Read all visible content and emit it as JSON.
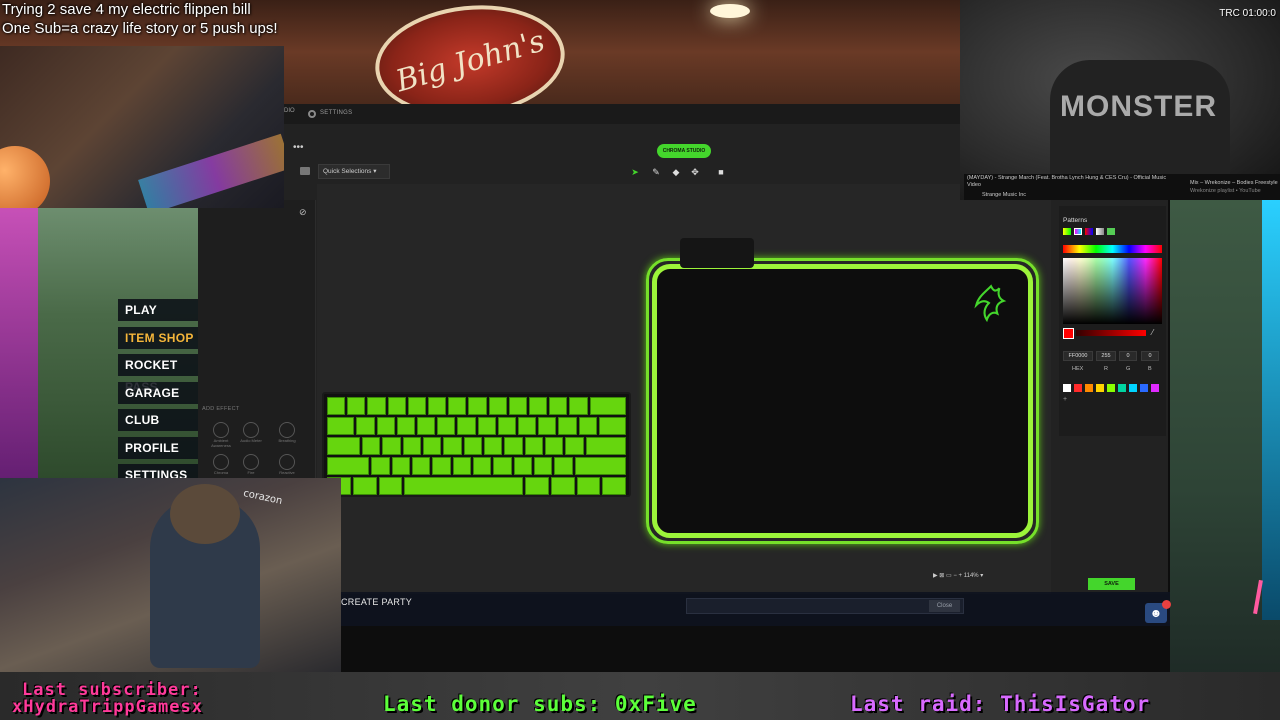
{
  "overlay": {
    "title_line1": "Trying 2 save 4 my electric flippen bill",
    "title_line2": "One Sub=a crazy life story or 5 push ups!",
    "clock": "TRC 01:00:0",
    "youtube": {
      "video_title": "(MAYDAY) - Strange March (Feat. Brotha Lynch Hung & CES Cru) - Official Music Video",
      "channel": "Strange Music Inc",
      "side_title": "Mix – Wrekonize – Bodies Freestyle",
      "side_sub": "Wrekonize playlist • YouTube"
    },
    "shirt_text": "MONSTER",
    "corazon": "corazon",
    "diner_sign": "Big John's"
  },
  "rocket_league": {
    "menu": [
      {
        "label": "PLAY",
        "active": false
      },
      {
        "label": "ITEM SHOP",
        "active": true
      },
      {
        "label": "ROCKET PASS",
        "active": false
      },
      {
        "label": "GARAGE",
        "active": false
      },
      {
        "label": "CLUB",
        "active": false
      },
      {
        "label": "PROFILE",
        "active": false
      },
      {
        "label": "SETTINGS",
        "active": false
      }
    ],
    "create_party": "CREATE PARTY",
    "close_label": "Close"
  },
  "synapse": {
    "tab_partial": "DIO",
    "settings_tab": "SETTINGS",
    "chroma_studio": "CHROMA STUDIO",
    "quick_selections": "Quick Selections",
    "add_effect": "ADD EFFECT",
    "effects": [
      {
        "label": "Ambient Awareness"
      },
      {
        "label": "Audio Meter"
      },
      {
        "label": "Breathing"
      },
      {
        "label": "Chroma"
      },
      {
        "label": "Fire"
      },
      {
        "label": "Reactive"
      }
    ],
    "zoom": "114%",
    "save_label": "SAVE",
    "picker": {
      "title": "Patterns",
      "hex": "FF0000",
      "r": "255",
      "g": "0",
      "b": "0",
      "hex_label": "HEX",
      "r_label": "R",
      "g_label": "G",
      "b_label": "B",
      "current_color": "#ff0000",
      "swatches": [
        "#ffffff",
        "#ff2a2a",
        "#ff8a00",
        "#ffd400",
        "#8aff00",
        "#00d4a0",
        "#00d4ff",
        "#2a6aff",
        "#e02aff"
      ]
    },
    "accent": "#44d62c"
  },
  "ticker": {
    "sub_label": "Last subscriber:",
    "sub_name": "xHydraTrippGamesx",
    "donor": "Last donor subs: 0xFive",
    "raid": "Last raid: ThisIsGator"
  }
}
